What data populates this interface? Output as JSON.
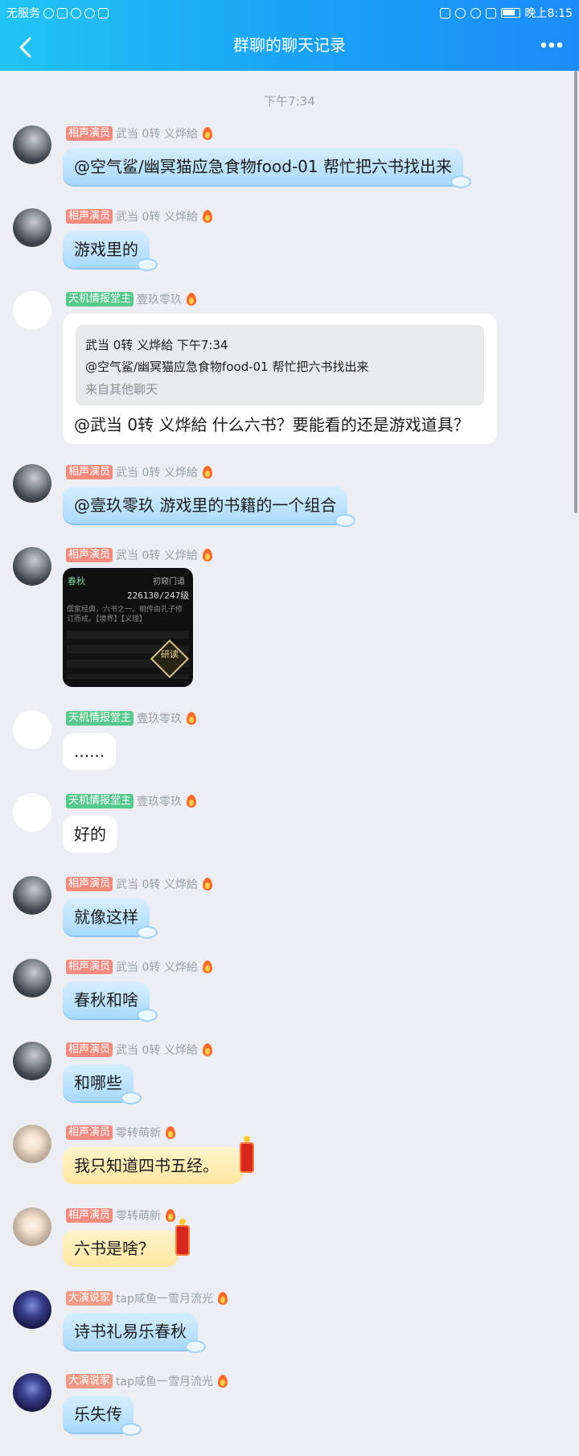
{
  "status": {
    "carrier": "无服务",
    "time": "晚上8:15"
  },
  "nav": {
    "title": "群聊的聊天记录"
  },
  "time_separator": "下午7:34",
  "messages": [
    {
      "tag": "相声演员",
      "sender": "武当  0转  义烨給",
      "text": "@空气鲨/幽冥猫应急食物food-01 帮忙把六书找出来"
    },
    {
      "tag": "相声演员",
      "sender": "武当  0转  义烨給",
      "text": "游戏里的"
    },
    {
      "tag": "天机情报堂主",
      "sender": "壹玖零玖",
      "quote": {
        "header": "武当  0转  义烨給 下午7:34",
        "text": "@空气鲨/幽冥猫应急食物food-01 帮忙把六书找出来",
        "source": "来自其他聊天"
      },
      "text": "@武当  0转  义烨給 什么六书？要能看的还是游戏道具？"
    },
    {
      "tag": "相声演员",
      "sender": "武当  0转  义烨給",
      "text": "@壹玖零玖 游戏里的书籍的一个组合"
    },
    {
      "tag": "相声演员",
      "sender": "武当  0转  义烨給",
      "image": {
        "title": "春秋",
        "right": "初窥门道",
        "score": "226130/247级",
        "desc": "儒家经典，六书之一。相传由孔子修订而成。【境界】【义理】",
        "read": "研读"
      }
    },
    {
      "tag": "天机情报堂主",
      "sender": "壹玖零玖",
      "text": "......"
    },
    {
      "tag": "天机情报堂主",
      "sender": "壹玖零玖",
      "text": "好的"
    },
    {
      "tag": "相声演员",
      "sender": "武当  0转  义烨給",
      "text": "就像这样"
    },
    {
      "tag": "相声演员",
      "sender": "武当  0转  义烨給",
      "text": "春秋和啥"
    },
    {
      "tag": "相声演员",
      "sender": "武当  0转  义烨給",
      "text": "和哪些"
    },
    {
      "tag": "相声演员",
      "sender": "零转萌新",
      "text": "我只知道四书五经。"
    },
    {
      "tag": "相声演员",
      "sender": "零转萌新",
      "text": "六书是啥？"
    },
    {
      "tag": "大演说家",
      "sender": "tap咸鱼一雪月流光",
      "text": "诗书礼易乐春秋"
    },
    {
      "tag": "大演说家",
      "sender": "tap咸鱼一雪月流光",
      "text": "乐失传"
    }
  ]
}
